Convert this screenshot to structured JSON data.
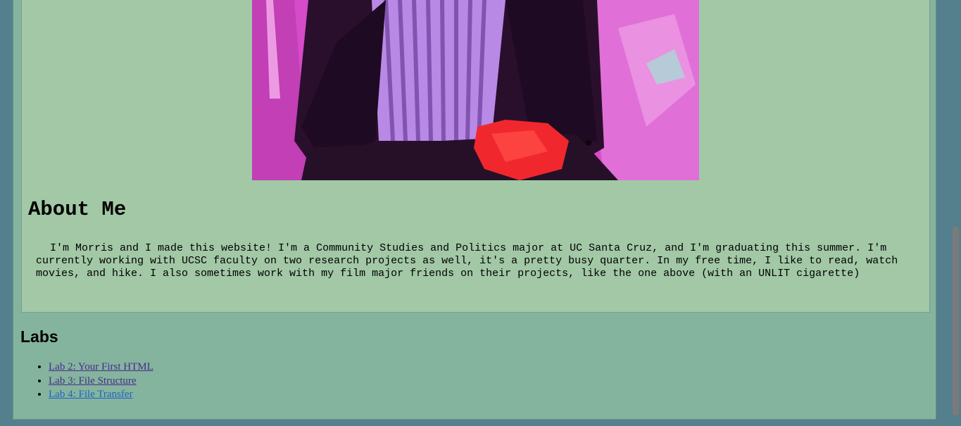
{
  "about": {
    "title": "About Me",
    "text": "I'm Morris and I made this website! I'm a Community Studies and Politics major at UC Santa Cruz, and I'm graduating this summer. I'm currently working with UCSC faculty on two research projects as well, it's a pretty busy quarter. In my free time, I like to read, watch movies, and hike. I also sometimes work with my film major friends on their projects, like the one above (with an UNLIT cigarette)"
  },
  "labs": {
    "title": "Labs",
    "items": [
      {
        "label": "Lab 2: Your First HTML"
      },
      {
        "label": "Lab 3: File Structure"
      },
      {
        "label": "Lab 4: File Transfer"
      }
    ]
  },
  "colors": {
    "page_background": "#547f8c",
    "outer_panel": "#84b49e",
    "card": "#a2c8a6",
    "link_visited": "#4b2a8c",
    "link": "#1f63c4"
  }
}
